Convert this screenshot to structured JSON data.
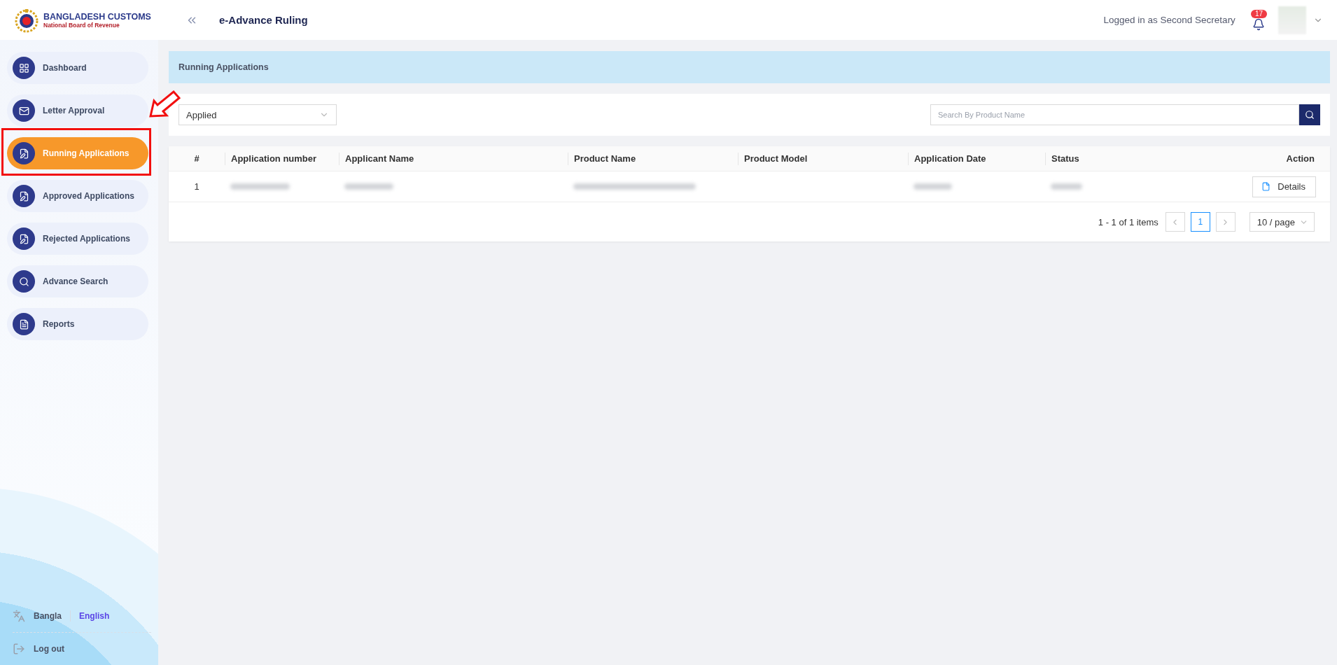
{
  "header": {
    "logo_title": "BANGLADESH CUSTOMS",
    "logo_subtitle": "National Board of Revenue",
    "app_title": "e-Advance Ruling",
    "logged_in": "Logged in as Second Secretary",
    "notification_count": "17"
  },
  "sidebar": {
    "items": [
      {
        "label": "Dashboard",
        "selected": false,
        "highlighted": false
      },
      {
        "label": "Letter Approval",
        "selected": false,
        "highlighted": false
      },
      {
        "label": "Running Applications",
        "selected": true,
        "highlighted": true
      },
      {
        "label": "Approved Applications",
        "selected": false,
        "highlighted": false
      },
      {
        "label": "Rejected Applications",
        "selected": false,
        "highlighted": false
      },
      {
        "label": "Advance Search",
        "selected": false,
        "highlighted": false
      },
      {
        "label": "Reports",
        "selected": false,
        "highlighted": false
      }
    ],
    "languages": [
      {
        "label": "Bangla",
        "selected": false
      },
      {
        "label": "English",
        "selected": true
      }
    ],
    "logout": "Log out"
  },
  "page_title": "Running Applications",
  "filter": {
    "value": "Applied"
  },
  "search": {
    "placeholder": "Search By Product Name"
  },
  "table": {
    "columns": [
      "#",
      "Application number",
      "Applicant Name",
      "Product Name",
      "Product Model",
      "Application Date",
      "Status",
      "Action"
    ],
    "rows": [
      {
        "cells": [
          {
            "kind": "text",
            "text": "1"
          },
          {
            "kind": "blurred"
          },
          {
            "kind": "blurred"
          },
          {
            "kind": "blurred"
          },
          {
            "kind": "empty"
          },
          {
            "kind": "blurred"
          },
          {
            "kind": "blurred"
          },
          {
            "kind": "button",
            "text": "Details"
          }
        ]
      }
    ]
  },
  "pagination": {
    "summary": "1 - 1 of 1 items",
    "pages": [
      {
        "label": "1",
        "selected": true
      }
    ],
    "page_size": "10 / page"
  }
}
